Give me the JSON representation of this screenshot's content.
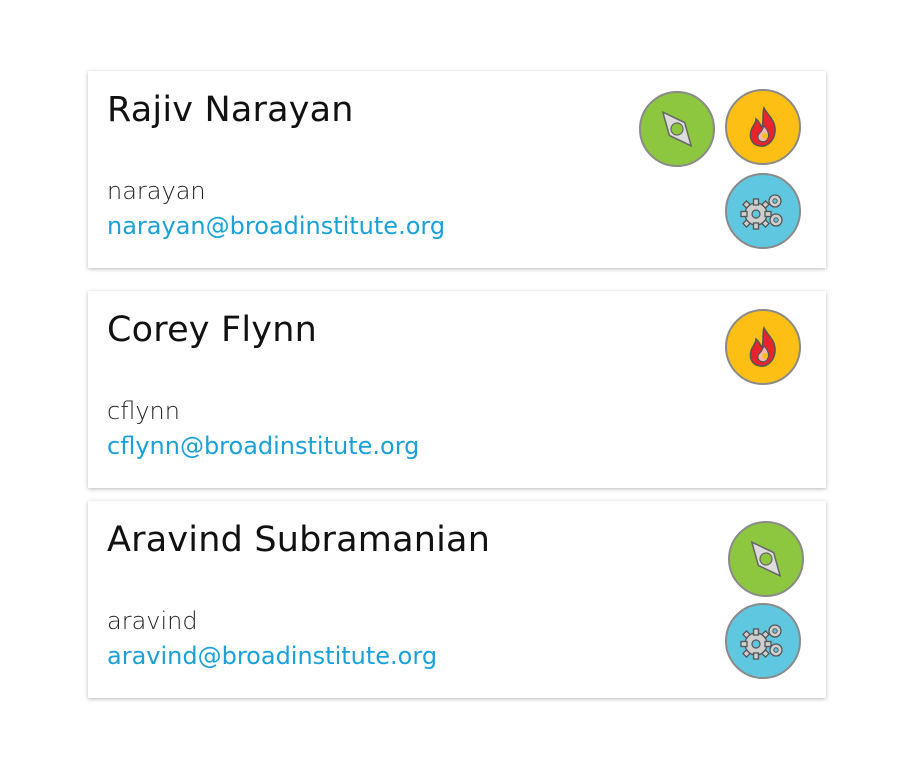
{
  "people": [
    {
      "name": "Rajiv Narayan",
      "username": "narayan",
      "email": "narayan@broadinstitute.org",
      "badges": [
        "compass-icon",
        "fire-icon",
        "gears-icon"
      ]
    },
    {
      "name": "Corey Flynn",
      "username": "cflynn",
      "email": "cflynn@broadinstitute.org",
      "badges": [
        "fire-icon"
      ]
    },
    {
      "name": "Aravind Subramanian",
      "username": "aravind",
      "email": "aravind@broadinstitute.org",
      "badges": [
        "compass-icon",
        "gears-icon"
      ]
    }
  ],
  "colors": {
    "compass_badge": "#8dc63f",
    "fire_badge": "#fdbf14",
    "gears_badge": "#5fc8e0",
    "email_link": "#1aa1d8"
  }
}
